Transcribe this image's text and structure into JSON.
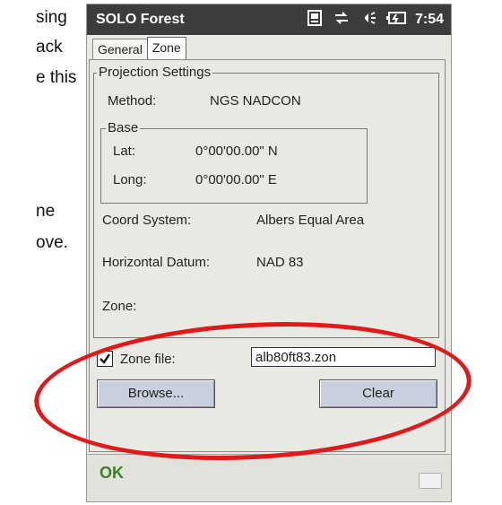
{
  "background_text": [
    "sing",
    "ack",
    "e this",
    "ne",
    "ove."
  ],
  "device": {
    "app_title": "SOLO Forest",
    "clock": "7:54",
    "status_icons": [
      "phone-icon",
      "sync-arrows-icon",
      "speaker-icon",
      "battery-icon"
    ]
  },
  "tabs": [
    {
      "label": "General",
      "active": false
    },
    {
      "label": "Zone",
      "active": true
    }
  ],
  "projection": {
    "legend": "Projection Settings",
    "method_label": "Method:",
    "method_value": "NGS NADCON",
    "base": {
      "legend": "Base",
      "lat_label": "Lat:",
      "lat_value": "0°00'00.00\" N",
      "long_label": "Long:",
      "long_value": "0°00'00.00\" E"
    },
    "coord_system_label": "Coord System:",
    "coord_system_value": "Albers Equal Area",
    "datum_label": "Horizontal Datum:",
    "datum_value": "NAD 83",
    "zone_label": "Zone:"
  },
  "zone_file": {
    "checked": true,
    "label": "Zone file:",
    "value": "alb80ft83.zon"
  },
  "buttons": {
    "browse": "Browse...",
    "clear": "Clear"
  },
  "softkeys": {
    "left": "OK"
  },
  "colors": {
    "annotation": "#e0191b",
    "titlebar": "#3c3c3c",
    "ok_key": "#3a7f2b",
    "button": "#c9cfdd"
  }
}
